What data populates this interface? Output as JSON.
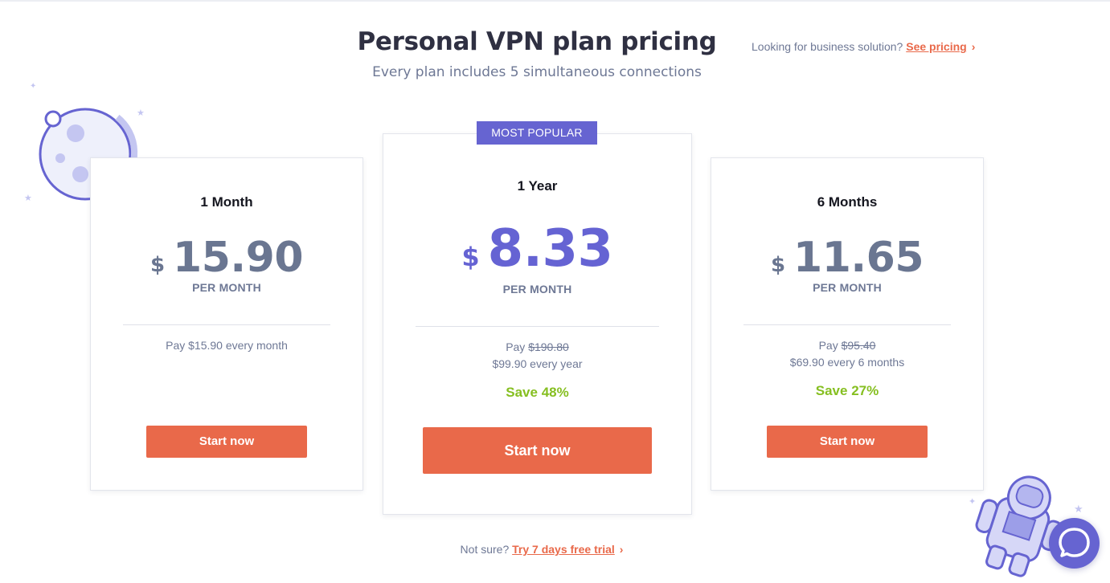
{
  "header": {
    "title": "Personal VPN plan pricing",
    "subtitle": "Every plan includes 5 simultaneous connections",
    "business_prefix": "Looking for business solution?",
    "business_link": "See pricing"
  },
  "plans": [
    {
      "name": "1 Month",
      "currency": "$",
      "price": "15.90",
      "per": "PER MONTH",
      "pay_line": "Pay $15.90 every month",
      "button": "Start now"
    },
    {
      "badge": "MOST POPULAR",
      "name": "1 Year",
      "currency": "$",
      "price": "8.33",
      "per": "PER MONTH",
      "pay_prefix": "Pay ",
      "pay_old": "$190.80",
      "pay_new": "$99.90 every year",
      "save": "Save 48%",
      "button": "Start now"
    },
    {
      "name": "6 Months",
      "currency": "$",
      "price": "11.65",
      "per": "PER MONTH",
      "pay_prefix": "Pay ",
      "pay_old": "$95.40",
      "pay_new": "$69.90 every 6 months",
      "save": "Save 27%",
      "button": "Start now"
    }
  ],
  "footer": {
    "prefix": "Not sure?",
    "link": "Try 7 days free trial"
  },
  "colors": {
    "accent": "#e9694a",
    "brand": "#6664d1",
    "save": "#86bf21",
    "muted": "#6e7895"
  },
  "icons": [
    "moon-illustration",
    "astronaut-illustration",
    "chat-icon",
    "chevron-right-icon",
    "star-icon"
  ]
}
